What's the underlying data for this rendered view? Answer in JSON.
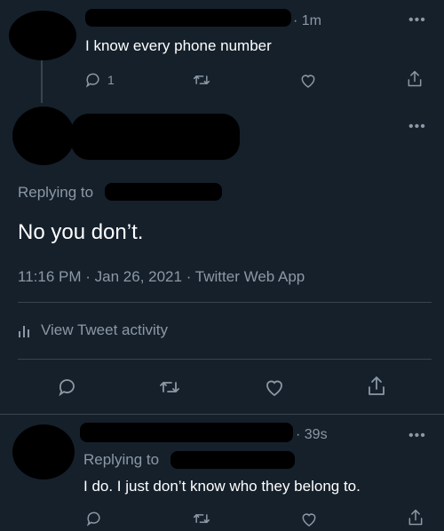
{
  "tweet1": {
    "time_sep": "·",
    "time": "1m",
    "text": "I know every phone number",
    "reply_count": "1"
  },
  "main_tweet": {
    "replying_label": "Replying to",
    "text": "No you don’t.",
    "time": "11:16 PM",
    "date": "Jan 26, 2021",
    "source": "Twitter Web App",
    "meta_sep": "·",
    "activity_label": "View Tweet activity"
  },
  "tweet3": {
    "time_sep": "·",
    "time": "39s",
    "replying_label": "Replying to",
    "text": "I do. I just don’t know who they belong to."
  },
  "icons": {
    "more": "more-horizontal-icon",
    "reply": "reply-bubble-icon",
    "retweet": "retweet-icon",
    "like": "heart-icon",
    "share": "share-icon",
    "activity": "bar-chart-icon"
  },
  "colors": {
    "background": "#15202b",
    "text": "#ffffff",
    "muted": "#8b98a5",
    "divider": "#38444d"
  }
}
